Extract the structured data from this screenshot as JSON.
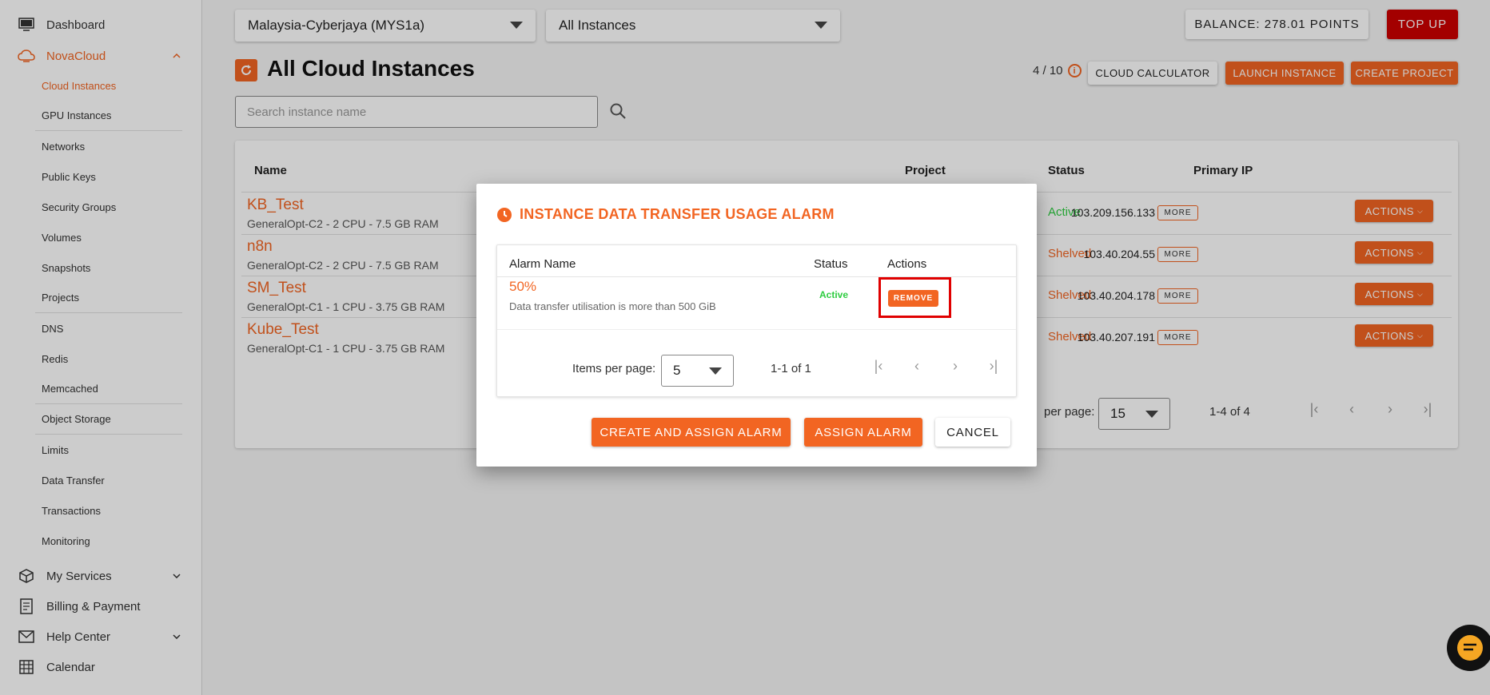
{
  "sidebar": {
    "dashboard": "Dashboard",
    "novacloud": "NovaCloud",
    "sub_items": [
      "Cloud Instances",
      "GPU Instances",
      "Networks",
      "Public Keys",
      "Security Groups",
      "Volumes",
      "Snapshots",
      "Projects",
      "DNS",
      "Redis",
      "Memcached",
      "Object Storage",
      "Limits",
      "Data Transfer",
      "Transactions",
      "Monitoring"
    ],
    "my_services": "My Services",
    "billing": "Billing & Payment",
    "help": "Help Center",
    "calendar": "Calendar"
  },
  "header": {
    "region": "Malaysia-Cyberjaya (MYS1a)",
    "filter": "All Instances",
    "balance": "BALANCE: 278.01 POINTS",
    "topup": "TOP UP"
  },
  "page": {
    "title": "All Cloud Instances",
    "quota": "4 / 10",
    "cloud_calculator": "CLOUD CALCULATOR",
    "launch_instance": "LAUNCH INSTANCE",
    "create_project": "CREATE PROJECT",
    "search_placeholder": "Search instance name"
  },
  "table": {
    "headers": {
      "name": "Name",
      "project": "Project",
      "status": "Status",
      "primary_ip": "Primary IP"
    },
    "rows": [
      {
        "name": "KB_Test",
        "spec": "GeneralOpt-C2 - 2 CPU - 7.5 GB RAM",
        "status": "Active",
        "ip": "103.209.156.133"
      },
      {
        "name": "n8n",
        "spec": "GeneralOpt-C2 - 2 CPU - 7.5 GB RAM",
        "status": "Shelved",
        "ip": "103.40.204.55"
      },
      {
        "name": "SM_Test",
        "spec": "GeneralOpt-C1 - 1 CPU - 3.75 GB RAM",
        "status": "Shelved",
        "ip": "103.40.204.178"
      },
      {
        "name": "Kube_Test",
        "spec": "GeneralOpt-C1 - 1 CPU - 3.75 GB RAM",
        "status": "Shelved",
        "ip": "103.40.207.191"
      }
    ],
    "more_label": "MORE",
    "actions_label": "ACTIONS",
    "pager": {
      "label": "per page:",
      "size": "15",
      "range": "1-4 of 4"
    }
  },
  "modal": {
    "title": "INSTANCE DATA TRANSFER USAGE ALARM",
    "headers": {
      "alarm_name": "Alarm Name",
      "status": "Status",
      "actions": "Actions"
    },
    "alarm": {
      "name": "50%",
      "description": "Data transfer utilisation is more than 500 GiB",
      "status": "Active",
      "remove": "REMOVE"
    },
    "pager": {
      "label": "Items per page:",
      "size": "5",
      "range": "1-1 of 1"
    },
    "buttons": {
      "create_assign": "CREATE AND ASSIGN ALARM",
      "assign": "ASSIGN ALARM",
      "cancel": "CANCEL"
    }
  },
  "colors": {
    "accent": "#f26522",
    "active": "#2ecc40",
    "shelved": "#f26522",
    "topup": "#cc0000"
  }
}
